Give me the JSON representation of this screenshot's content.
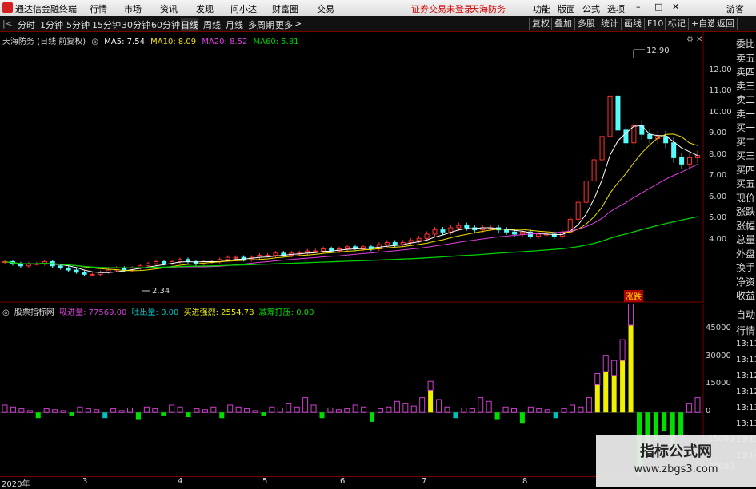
{
  "app": {
    "brand": "通达信金融终端",
    "menu": [
      "行情",
      "市场",
      "资讯",
      "发现",
      "问小达",
      "财富圈",
      "交易"
    ],
    "status_text": "证券交易未登录",
    "stock_name_top": "天海防务",
    "right_menu": [
      "功能",
      "版面",
      "公式",
      "选项"
    ],
    "guest": "游客"
  },
  "toolbar": {
    "timeframes": [
      "分时",
      "1分钟",
      "5分钟",
      "15分钟",
      "30分钟",
      "60分钟",
      "日线",
      "周线",
      "月线",
      "多周期",
      "更多"
    ],
    "active_timeframe": "日线",
    "buttons": [
      "复权",
      "叠加",
      "多股",
      "统计",
      "画线",
      "F10",
      "标记",
      "+自选",
      "返回"
    ]
  },
  "main_legend": {
    "title": "天海防务 (日线 前复权)",
    "ma5": "MA5: 7.54",
    "ma10": "MA10: 8.09",
    "ma20": "MA20: 8.52",
    "ma60": "MA60: 5.81",
    "colors": {
      "ma5": "#ffffff",
      "ma10": "#f0e000",
      "ma20": "#e040e0",
      "ma60": "#00d000"
    }
  },
  "indicator_legend": {
    "name": "股票指标网",
    "xijin": "吸进量: 77569.00",
    "tuchu": "吐出量: 0.00",
    "mairu": "买进强烈: 2554.78",
    "jianchou": "减筹打压: 0.00"
  },
  "annotations": {
    "high": "12.90",
    "low": "2.34",
    "zhangdie_tag": "涨跌"
  },
  "main_yaxis": [
    "12.00",
    "11.00",
    "10.00",
    "9.00",
    "8.00",
    "7.00",
    "6.00",
    "5.00",
    "4.00"
  ],
  "ind_yaxis": [
    "45000",
    "30000",
    "15000",
    "0",
    "-15000",
    "-30000"
  ],
  "dates": [
    "2020年",
    "3",
    "4",
    "5",
    "6",
    "7",
    "8"
  ],
  "right_panel": [
    "委比",
    "卖五",
    "卖四",
    "卖三",
    "卖二",
    "卖一",
    "买一",
    "买二",
    "买三",
    "买四",
    "买五",
    "现价",
    "涨跌",
    "涨幅",
    "总量",
    "外盘",
    "换手",
    "净资",
    "收益",
    "自动",
    "行情",
    "13:11",
    "13:11",
    "13:12",
    "13:12",
    "13:13",
    "13:13",
    "13:13",
    "13:14"
  ],
  "watermark": {
    "line1": "指标公式网",
    "line2": "www.zbgs3.com"
  },
  "chart_data": {
    "type": "candlestick",
    "price_range": [
      2.0,
      13.3
    ],
    "close_series_approx": [
      3.0,
      2.9,
      2.8,
      2.9,
      2.9,
      3.0,
      2.8,
      2.7,
      2.6,
      2.5,
      2.4,
      2.4,
      2.5,
      2.6,
      2.7,
      2.6,
      2.7,
      2.8,
      2.9,
      3.0,
      2.9,
      3.0,
      3.1,
      3.0,
      2.9,
      3.0,
      3.0,
      3.1,
      3.2,
      3.2,
      3.1,
      3.2,
      3.3,
      3.3,
      3.4,
      3.3,
      3.4,
      3.4,
      3.5,
      3.5,
      3.6,
      3.5,
      3.6,
      3.7,
      3.6,
      3.7,
      3.6,
      3.8,
      3.9,
      3.8,
      3.9,
      4.0,
      4.1,
      4.3,
      4.5,
      4.4,
      4.6,
      4.7,
      4.6,
      4.5,
      4.6,
      4.6,
      4.5,
      4.4,
      4.3,
      4.4,
      4.2,
      4.3,
      4.3,
      4.2,
      4.4,
      5.0,
      5.8,
      6.8,
      7.8,
      8.9,
      10.8,
      9.2,
      8.6,
      9.4,
      9.0,
      8.8,
      8.9,
      8.6,
      7.9,
      7.6,
      7.9,
      8.0
    ],
    "indicator": {
      "name": "股票指标网",
      "series": [
        {
          "name": "吸进量",
          "color": "#d040d0"
        },
        {
          "name": "吐出量",
          "color": "#00c0c0"
        },
        {
          "name": "买进强烈",
          "color": "#f0f000"
        },
        {
          "name": "减筹打压",
          "color": "#00e000"
        }
      ],
      "range": [
        -30000,
        50000
      ],
      "bars_approx": [
        4000,
        3000,
        2000,
        1000,
        -3000,
        2000,
        1500,
        1000,
        -2000,
        3000,
        2000,
        1500,
        -3000,
        2000,
        1000,
        2500,
        -4000,
        3000,
        2000,
        -2000,
        4000,
        3000,
        -2500,
        2000,
        1500,
        3000,
        -3000,
        4000,
        3000,
        2000,
        1000,
        -2000,
        3000,
        2500,
        5000,
        3000,
        8000,
        4000,
        -3000,
        2500,
        1500,
        2000,
        4000,
        3000,
        -5000,
        2000,
        3000,
        6000,
        5000,
        3500,
        8000,
        12000,
        7000,
        3000,
        -3000,
        2500,
        2000,
        8000,
        6000,
        -4000,
        3000,
        2000,
        -6000,
        3000,
        2000,
        1500,
        -3000,
        2000,
        4000,
        3000,
        8000,
        15000,
        22000,
        20000,
        28000,
        47000,
        -35000,
        -22000,
        -15000,
        -10000,
        -20000,
        -12000,
        5000,
        8000
      ]
    }
  }
}
